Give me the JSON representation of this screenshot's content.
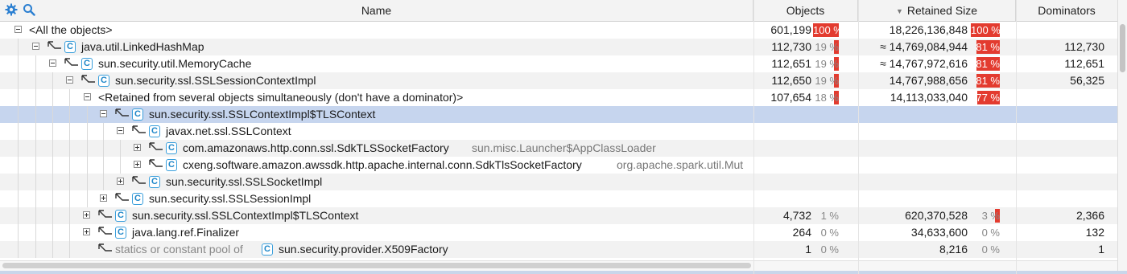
{
  "header": {
    "name": "Name",
    "objects": "Objects",
    "retained_size": "Retained Size",
    "dominators": "Dominators",
    "sort_indicator": "▼"
  },
  "colors": {
    "bar": "#e33b2f",
    "selection": "#c6d5ee",
    "badge": "#3a9fdc"
  },
  "rows": [
    {
      "name": "<All the objects>",
      "objects": "601,199",
      "objects_pct": "100 %",
      "objects_frac": 1.0,
      "retained": "18,226,136,848",
      "retained_pct": "100 %",
      "retained_frac": 1.0,
      "dominators": ""
    },
    {
      "name": "java.util.LinkedHashMap",
      "objects": "112,730",
      "objects_pct": "19 %",
      "objects_frac": 0.19,
      "retained": "≈ 14,769,084,944",
      "retained_pct": "81 %",
      "retained_frac": 0.81,
      "dominators": "112,730"
    },
    {
      "name": "sun.security.util.MemoryCache",
      "objects": "112,651",
      "objects_pct": "19 %",
      "objects_frac": 0.19,
      "retained": "≈ 14,767,972,616",
      "retained_pct": "81 %",
      "retained_frac": 0.81,
      "dominators": "112,651"
    },
    {
      "name": "sun.security.ssl.SSLSessionContextImpl",
      "objects": "112,650",
      "objects_pct": "19 %",
      "objects_frac": 0.19,
      "retained": "14,767,988,656",
      "retained_pct": "81 %",
      "retained_frac": 0.81,
      "dominators": "56,325"
    },
    {
      "name": "<Retained from several objects simultaneously (don't have a dominator)>",
      "objects": "107,654",
      "objects_pct": "18 %",
      "objects_frac": 0.18,
      "retained": "14,113,033,040",
      "retained_pct": "77 %",
      "retained_frac": 0.77,
      "dominators": ""
    },
    {
      "name": "sun.security.ssl.SSLContextImpl$TLSContext",
      "objects": "",
      "objects_pct": "",
      "retained": "",
      "retained_pct": "",
      "dominators": ""
    },
    {
      "name": "javax.net.ssl.SSLContext",
      "objects": "",
      "objects_pct": "",
      "retained": "",
      "retained_pct": "",
      "dominators": ""
    },
    {
      "name": "com.amazonaws.http.conn.ssl.SdkTLSSocketFactory",
      "loader": "sun.misc.Launcher$AppClassLoader",
      "objects": "",
      "objects_pct": "",
      "retained": "",
      "retained_pct": "",
      "dominators": ""
    },
    {
      "name": "cxeng.software.amazon.awssdk.http.apache.internal.conn.SdkTlsSocketFactory",
      "loader": "org.apache.spark.util.Mut",
      "objects": "",
      "objects_pct": "",
      "retained": "",
      "retained_pct": "",
      "dominators": ""
    },
    {
      "name": "sun.security.ssl.SSLSocketImpl",
      "objects": "",
      "objects_pct": "",
      "retained": "",
      "retained_pct": "",
      "dominators": ""
    },
    {
      "name": "sun.security.ssl.SSLSessionImpl",
      "objects": "",
      "objects_pct": "",
      "retained": "",
      "retained_pct": "",
      "dominators": ""
    },
    {
      "name": "sun.security.ssl.SSLContextImpl$TLSContext",
      "objects": "4,732",
      "objects_pct": "1 %",
      "objects_frac": 0.01,
      "retained": "620,370,528",
      "retained_pct": "3 %",
      "retained_frac": 0.03,
      "dominators": "2,366"
    },
    {
      "name": "java.lang.ref.Finalizer",
      "objects": "264",
      "objects_pct": "0 %",
      "objects_frac": 0.0,
      "retained": "34,633,600",
      "retained_pct": "0 %",
      "retained_frac": 0.0,
      "dominators": "132"
    },
    {
      "name": "sun.security.provider.X509Factory",
      "prefix": "statics or constant pool of",
      "objects": "1",
      "objects_pct": "0 %",
      "objects_frac": 0.0,
      "retained": "8,216",
      "retained_pct": "0 %",
      "retained_frac": 0.0,
      "dominators": "1"
    }
  ]
}
